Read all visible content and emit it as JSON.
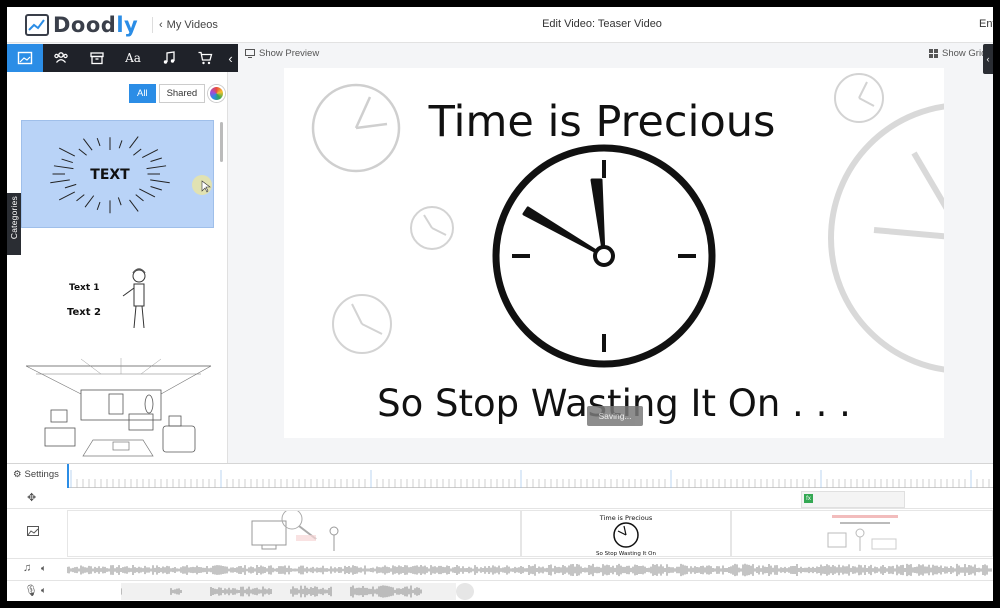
{
  "app": {
    "logo_text": "Doodly",
    "back_label": "My Videos",
    "title": "Edit Video: Teaser Video",
    "enter_label": "Ente"
  },
  "toolbar": {
    "tools": [
      "image-icon",
      "people-icon",
      "box-icon",
      "font-icon",
      "music-icon",
      "cart-icon"
    ],
    "active_tool": 0
  },
  "library": {
    "filters": [
      "All",
      "Shared"
    ],
    "active_filter": "All",
    "categories_label": "Categories",
    "thumb1_text": "TEXT",
    "thumb2_text1": "Text 1",
    "thumb2_text2": "Text 2"
  },
  "stage": {
    "show_preview_label": "Show Preview",
    "show_grid_label": "Show Grid",
    "headline": "Time is Precious",
    "subline": "So Stop Wasting It On . . .",
    "saving_label": "Saving..."
  },
  "timeline": {
    "settings_label": "Settings",
    "scene2_title": "Time is Precious",
    "scene2_sub": "So Stop Wasting It On"
  },
  "colors": {
    "accent": "#2b8de6",
    "toolbar_bg": "#1f2229",
    "selected_thumb": "#b9d3f7"
  }
}
